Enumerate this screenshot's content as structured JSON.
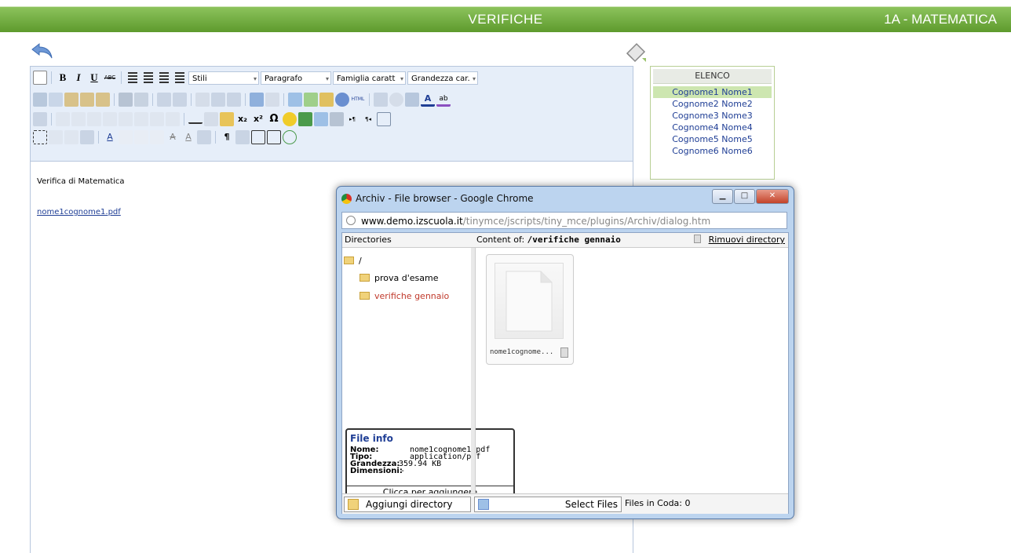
{
  "header": {
    "title": "VERIFICHE",
    "class": "1A - MATEMATICA"
  },
  "toolbar": {
    "styles": "Stili",
    "format": "Paragrafo",
    "font_family": "Famiglia caratt",
    "font_size": "Grandezza car."
  },
  "editor": {
    "heading": "Verifica di Matematica",
    "link": "nome1cognome1.pdf"
  },
  "elenco": {
    "title": "ELENCO",
    "items": [
      "Cognome1 Nome1",
      "Cognome2 Nome2",
      "Cognome3 Nome3",
      "Cognome4 Nome4",
      "Cognome5 Nome5",
      "Cognome6 Nome6"
    ]
  },
  "browser": {
    "title": "Archiv - File browser - Google Chrome",
    "url_domain": "www.demo.izscuola.it",
    "url_path": "/tinymce/jscripts/tiny_mce/plugins/Archiv/dialog.htm",
    "directories_label": "Directories",
    "content_label": "Content of:",
    "current_dir": "/verifiche gennaio",
    "remove_dir": "Rimuovi directory",
    "tree": [
      {
        "name": "/"
      },
      {
        "name": "prova d'esame"
      },
      {
        "name": "verifiche gennaio"
      }
    ],
    "file_name": "nome1cognome...",
    "info": {
      "title": "File info",
      "name_label": "Nome:",
      "name": "nome1cognome1.pdf",
      "type_label": "Tipo:",
      "type": "application/pdf",
      "size_label": "Grandezza:",
      "size": "359.94 KB",
      "dim_label": "Dimensioni:",
      "dim": "-",
      "add": "Clicca per aggiungere"
    },
    "add_dir": "Aggiungi directory",
    "select_files": "Select Files",
    "queue": "Files in Coda: 0"
  },
  "colors": {
    "accent": "#6aa83a",
    "link": "#1f3e95",
    "active_dir": "#c0392b"
  }
}
